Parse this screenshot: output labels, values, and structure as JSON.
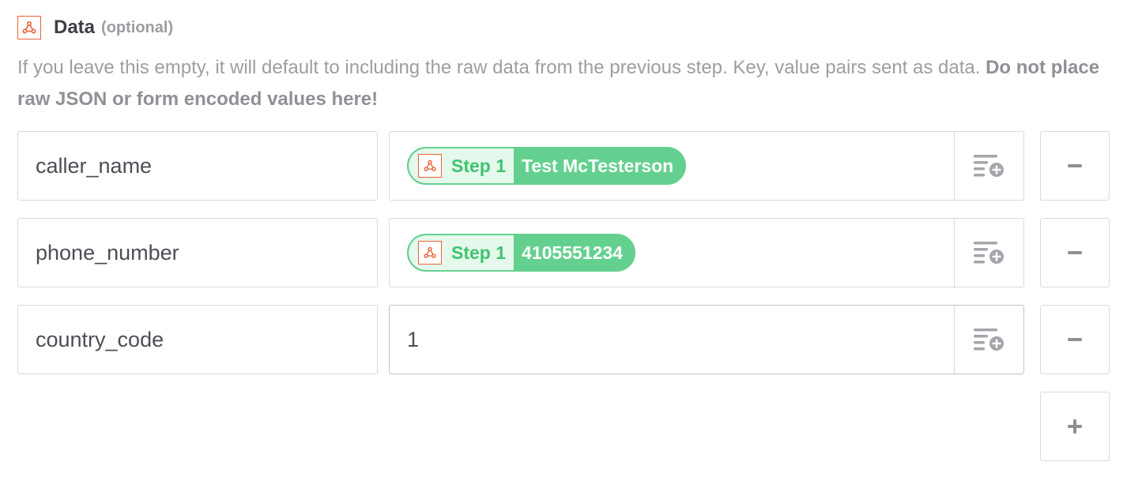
{
  "section": {
    "title": "Data",
    "optional_label": "(optional)",
    "help_text": "If you leave this empty, it will default to including the raw data from the previous step. Key, value pairs sent as data. ",
    "help_text_bold": "Do not place raw JSON or form encoded values here!",
    "icon": "webhook-icon"
  },
  "rows": [
    {
      "key": "caller_name",
      "value_type": "pill",
      "pill_step": "Step 1",
      "pill_value": "Test McTesterson"
    },
    {
      "key": "phone_number",
      "value_type": "pill",
      "pill_step": "Step 1",
      "pill_value": "4105551234"
    },
    {
      "key": "country_code",
      "value_type": "text",
      "value": "1"
    }
  ],
  "buttons": {
    "remove_icon": "minus-icon",
    "add_icon": "plus-icon",
    "insert_icon": "insert-data-icon"
  },
  "colors": {
    "pill_green": "#64d08f",
    "pill_light": "#e5f8ec",
    "step_text": "#3fc470",
    "webhook_orange": "#e8623a",
    "border": "#d7d9dc",
    "muted_text": "#9c9ea2"
  }
}
